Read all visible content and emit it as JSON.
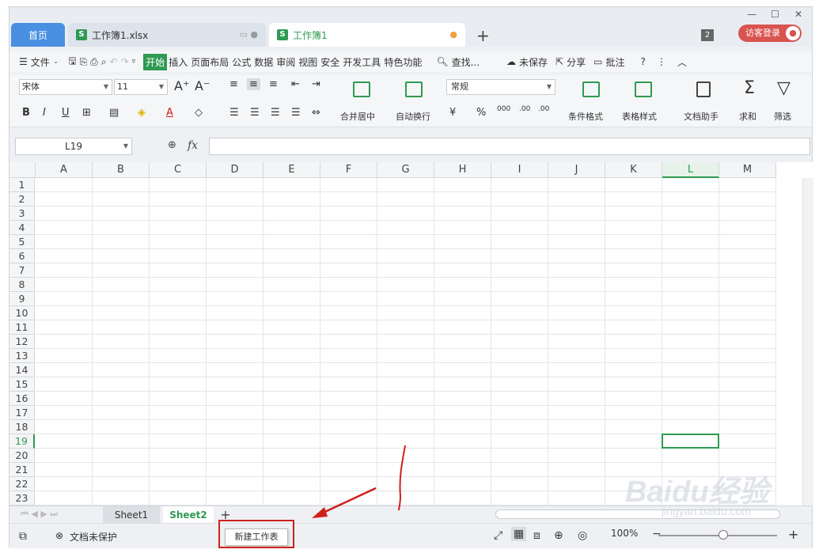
{
  "tabs": [
    {
      "label": "首页"
    },
    {
      "label": "工作簿1.xlsx"
    },
    {
      "label": "工作簿1"
    }
  ],
  "window": {
    "badge": "2",
    "login": "访客登录"
  },
  "menu": {
    "file": "文件",
    "items": [
      "开始",
      "插入",
      "页面布局",
      "公式",
      "数据",
      "审阅",
      "视图",
      "安全",
      "开发工具",
      "特色功能"
    ],
    "search": "查找...",
    "unsaved": "未保存",
    "share": "分享",
    "comment": "批注"
  },
  "ribbon": {
    "font": "宋体",
    "size": "11",
    "number_format": "常规",
    "merge": "合并居中",
    "wrap": "自动换行",
    "cond_format": "条件格式",
    "table_style": "表格样式",
    "doc_helper": "文档助手",
    "sum": "求和",
    "filter": "筛选"
  },
  "formula": {
    "cell": "L19",
    "fx": "fx",
    "value": ""
  },
  "grid": {
    "columns": [
      "A",
      "B",
      "C",
      "D",
      "E",
      "F",
      "G",
      "H",
      "I",
      "J",
      "K",
      "L",
      "M"
    ],
    "rows": [
      "1",
      "2",
      "3",
      "4",
      "5",
      "6",
      "7",
      "8",
      "9",
      "10",
      "11",
      "12",
      "13",
      "14",
      "15",
      "16",
      "17",
      "18",
      "19",
      "20",
      "21",
      "22",
      "23"
    ],
    "selected_col": "L",
    "selected_row": "19"
  },
  "sheets": {
    "items": [
      "Sheet1",
      "Sheet2"
    ],
    "active": "Sheet2"
  },
  "status": {
    "protect": "文档未保护",
    "tooltip": "新建工作表",
    "zoom": "100%"
  },
  "watermark": {
    "brand": "Baidu经验",
    "url": "jingyan.baidu.com"
  }
}
